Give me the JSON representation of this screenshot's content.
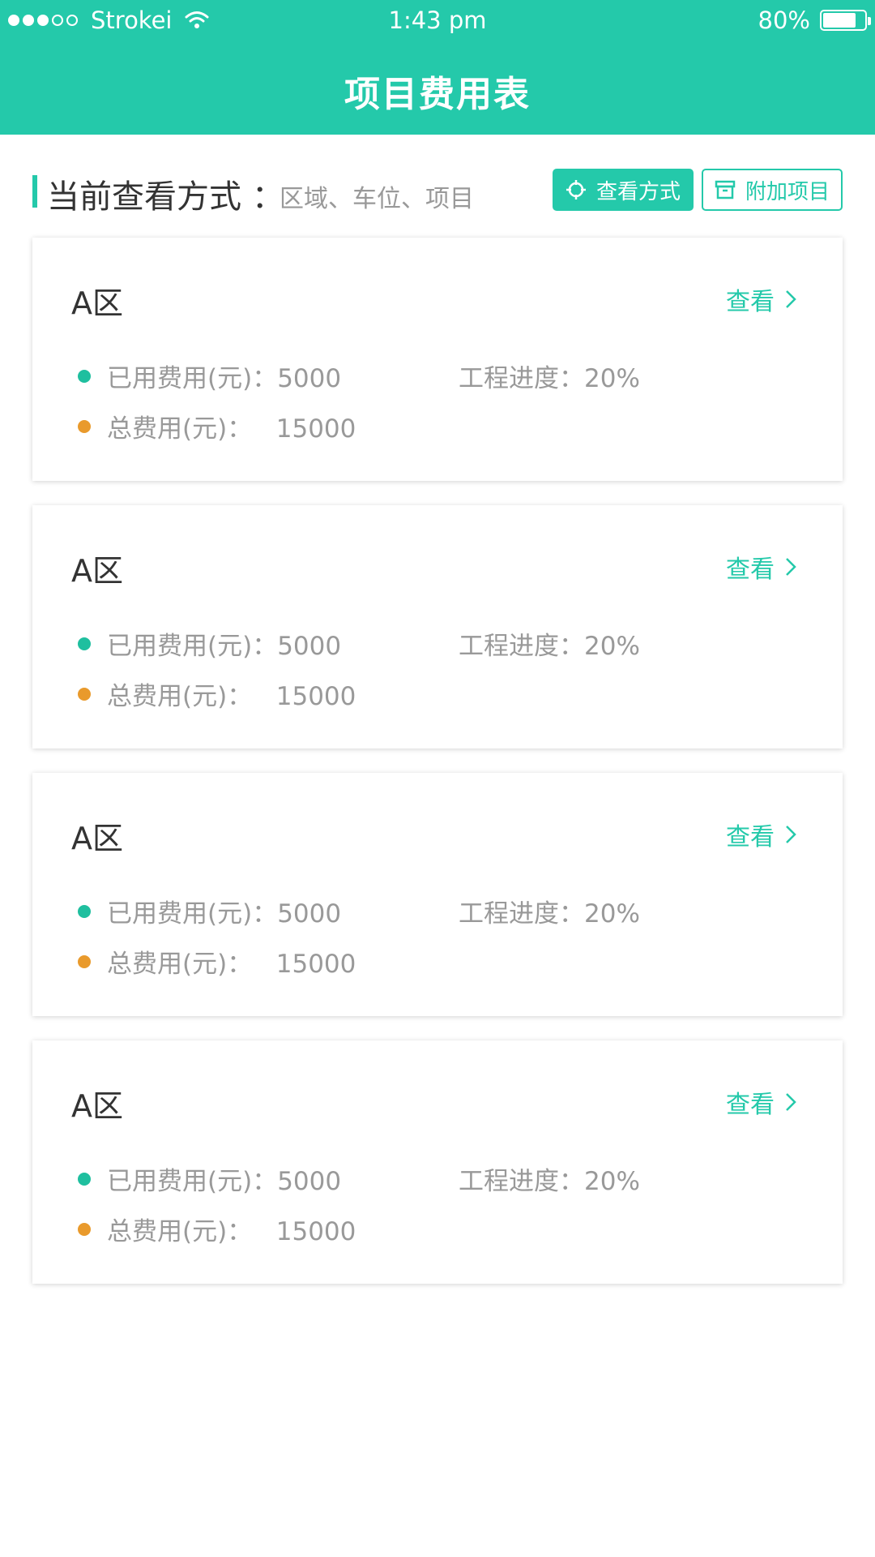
{
  "status_bar": {
    "carrier": "Strokei",
    "time": "1:43 pm",
    "battery": "80%",
    "battery_level": 0.8,
    "signal_dots": [
      true,
      true,
      true,
      false,
      false
    ]
  },
  "nav": {
    "title": "项目费用表"
  },
  "view_bar": {
    "label": "当前查看方式 ：",
    "value": "区域、车位、项目",
    "mode_button": "查看方式",
    "add_button": "附加项目"
  },
  "colors": {
    "accent": "#24c9aa",
    "orange": "#e99a2c",
    "muted": "#999999"
  },
  "icons": [
    "wifi-icon",
    "battery-icon",
    "crosshair-icon",
    "archive-box-icon",
    "chevron-right-icon"
  ],
  "cards": [
    {
      "title": "A区",
      "view": "查看",
      "used": "已用费用(元)：5000",
      "progress": "工程进度：20%",
      "total": "总费用(元)：   15000"
    },
    {
      "title": "A区",
      "view": "查看",
      "used": "已用费用(元)：5000",
      "progress": "工程进度：20%",
      "total": "总费用(元)：   15000"
    },
    {
      "title": "A区",
      "view": "查看",
      "used": "已用费用(元)：5000",
      "progress": "工程进度：20%",
      "total": "总费用(元)：   15000"
    },
    {
      "title": "A区",
      "view": "查看",
      "used": "已用费用(元)：5000",
      "progress": "工程进度：20%",
      "total": "总费用(元)：   15000"
    }
  ]
}
